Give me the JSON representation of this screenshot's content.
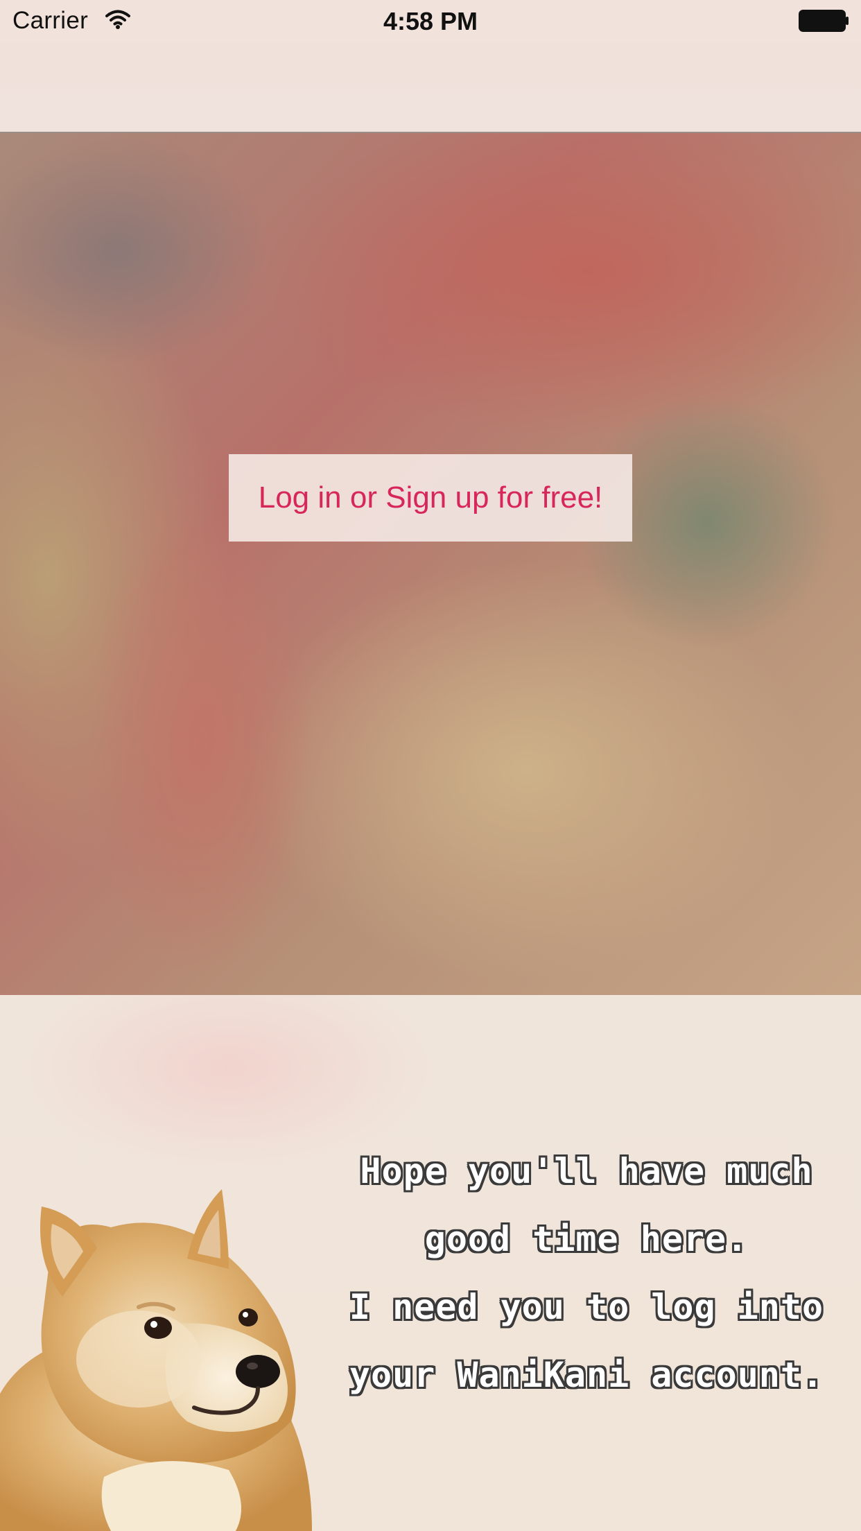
{
  "status_bar": {
    "carrier": "Carrier",
    "time": "4:58 PM",
    "wifi_icon": "wifi-icon",
    "battery_icon": "battery-full-icon"
  },
  "hero": {
    "login_button_label": "Log in or Sign up for free!"
  },
  "message": {
    "lines": [
      "Hope you'll have much",
      "good time here.",
      "I need you to log into",
      "your WaniKani account."
    ]
  },
  "colors": {
    "accent": "#d7275a",
    "background": "#f1e4dc"
  }
}
